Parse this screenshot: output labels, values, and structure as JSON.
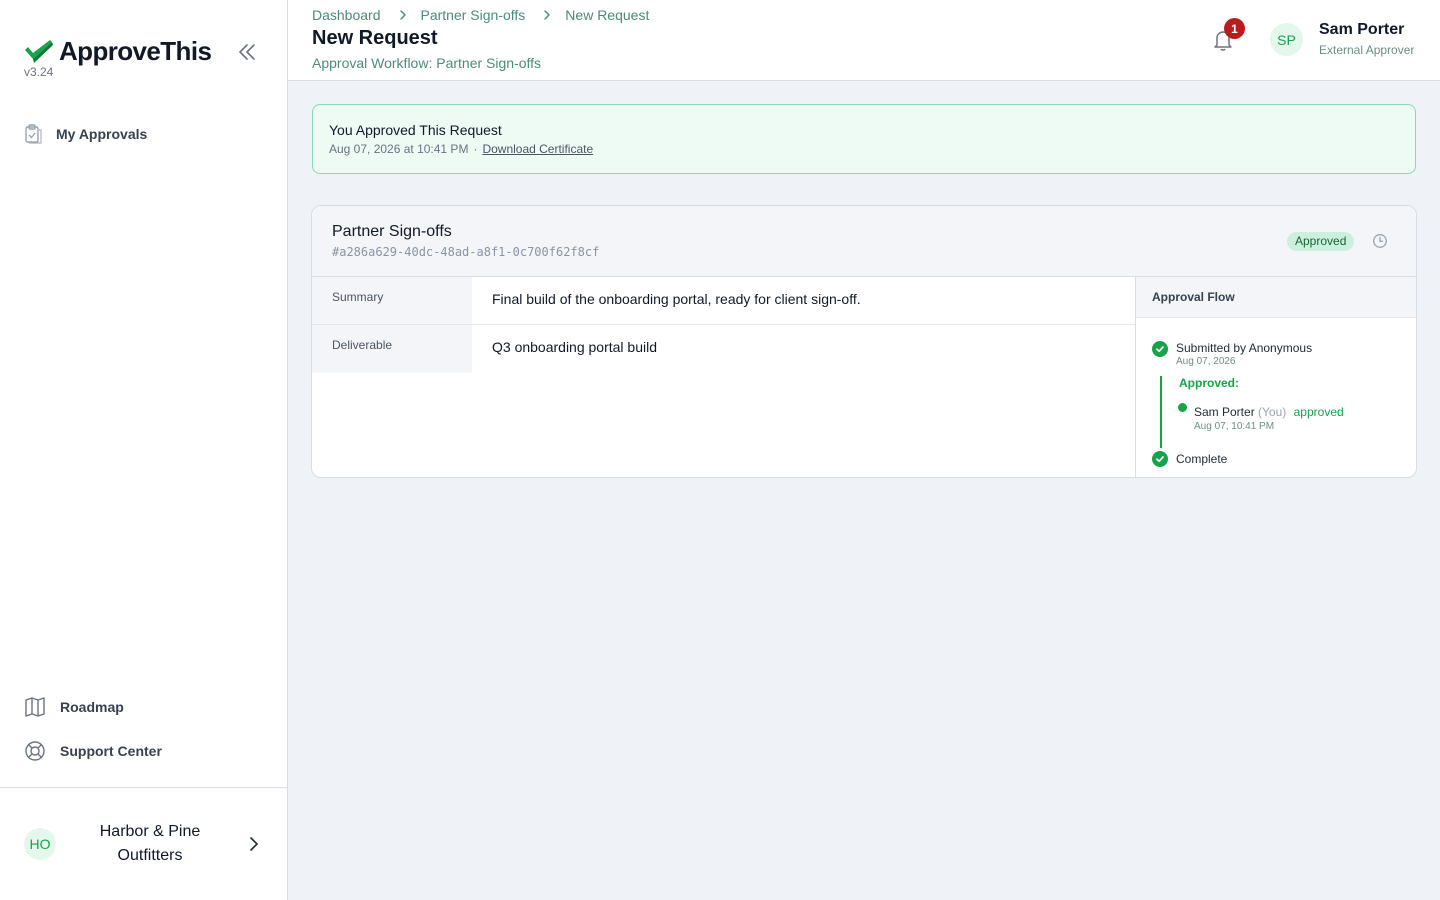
{
  "app": {
    "name": "ApproveThis",
    "version": "v3.24"
  },
  "sidebar": {
    "nav": [
      {
        "label": "My Approvals",
        "icon": "clipboard-check-icon"
      }
    ],
    "bottom_nav": [
      {
        "label": "Roadmap",
        "icon": "map-icon"
      },
      {
        "label": "Support Center",
        "icon": "lifebuoy-icon"
      }
    ],
    "org": {
      "initials": "HO",
      "name": "Harbor & Pine Outfitters"
    }
  },
  "header": {
    "breadcrumb": [
      "Dashboard",
      "Partner Sign-offs",
      "New Request"
    ],
    "title": "New Request",
    "subtitle": "Approval Workflow: Partner Sign-offs",
    "notifications_count": "1",
    "user": {
      "initials": "SP",
      "name": "Sam Porter",
      "role": "External Approver"
    }
  },
  "banner": {
    "title": "You Approved This Request",
    "timestamp": "Aug 07, 2026 at 10:41 PM",
    "separator": "·",
    "link": "Download Certificate"
  },
  "request": {
    "title": "Partner Sign-offs",
    "id": "#a286a629-40dc-48ad-a8f1-0c700f62f8cf",
    "status": "Approved",
    "fields": [
      {
        "label": "Summary",
        "value": "Final build of the onboarding portal, ready for client sign-off."
      },
      {
        "label": "Deliverable",
        "value": "Q3 onboarding portal build"
      }
    ]
  },
  "approval_flow": {
    "heading": "Approval Flow",
    "submitted": "Submitted by Anonymous",
    "submitted_date": "Aug 07, 2026",
    "approved_label": "Approved:",
    "approver": {
      "name": "Sam Porter",
      "you": "(You)",
      "action": "approved",
      "date": "Aug 07, 10:41 PM"
    },
    "complete": "Complete"
  },
  "colors": {
    "accent": "#16a34a",
    "link": "#4b8b77",
    "badge_red": "#b91c1c",
    "banner_bg": "#eefbf4"
  }
}
